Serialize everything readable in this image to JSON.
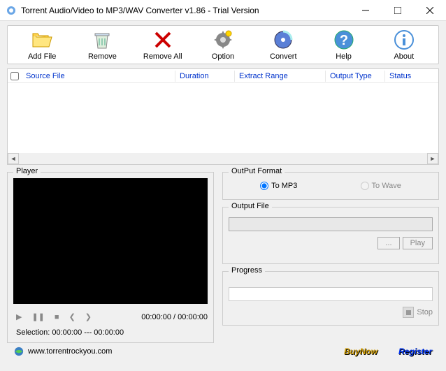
{
  "window": {
    "title": "Torrent Audio/Video to MP3/WAV Converter v1.86 - Trial Version"
  },
  "toolbar": {
    "add_file": "Add File",
    "remove": "Remove",
    "remove_all": "Remove All",
    "option": "Option",
    "convert": "Convert",
    "help": "Help",
    "about": "About"
  },
  "columns": {
    "source_file": "Source File",
    "duration": "Duration",
    "extract_range": "Extract Range",
    "output_type": "Output Type",
    "status": "Status"
  },
  "player": {
    "legend": "Player",
    "time": "00:00:00 / 00:00:00",
    "selection": "Selection: 00:00:00 --- 00:00:00"
  },
  "output_format": {
    "legend": "OutPut Format",
    "to_mp3": "To MP3",
    "to_wave": "To Wave"
  },
  "output_file": {
    "legend": "Output File",
    "browse": "...",
    "play": "Play"
  },
  "progress": {
    "legend": "Progress",
    "stop": "Stop"
  },
  "footer": {
    "url": "www.torrentrockyou.com",
    "buynow": "BuyNow",
    "register": "Register"
  }
}
